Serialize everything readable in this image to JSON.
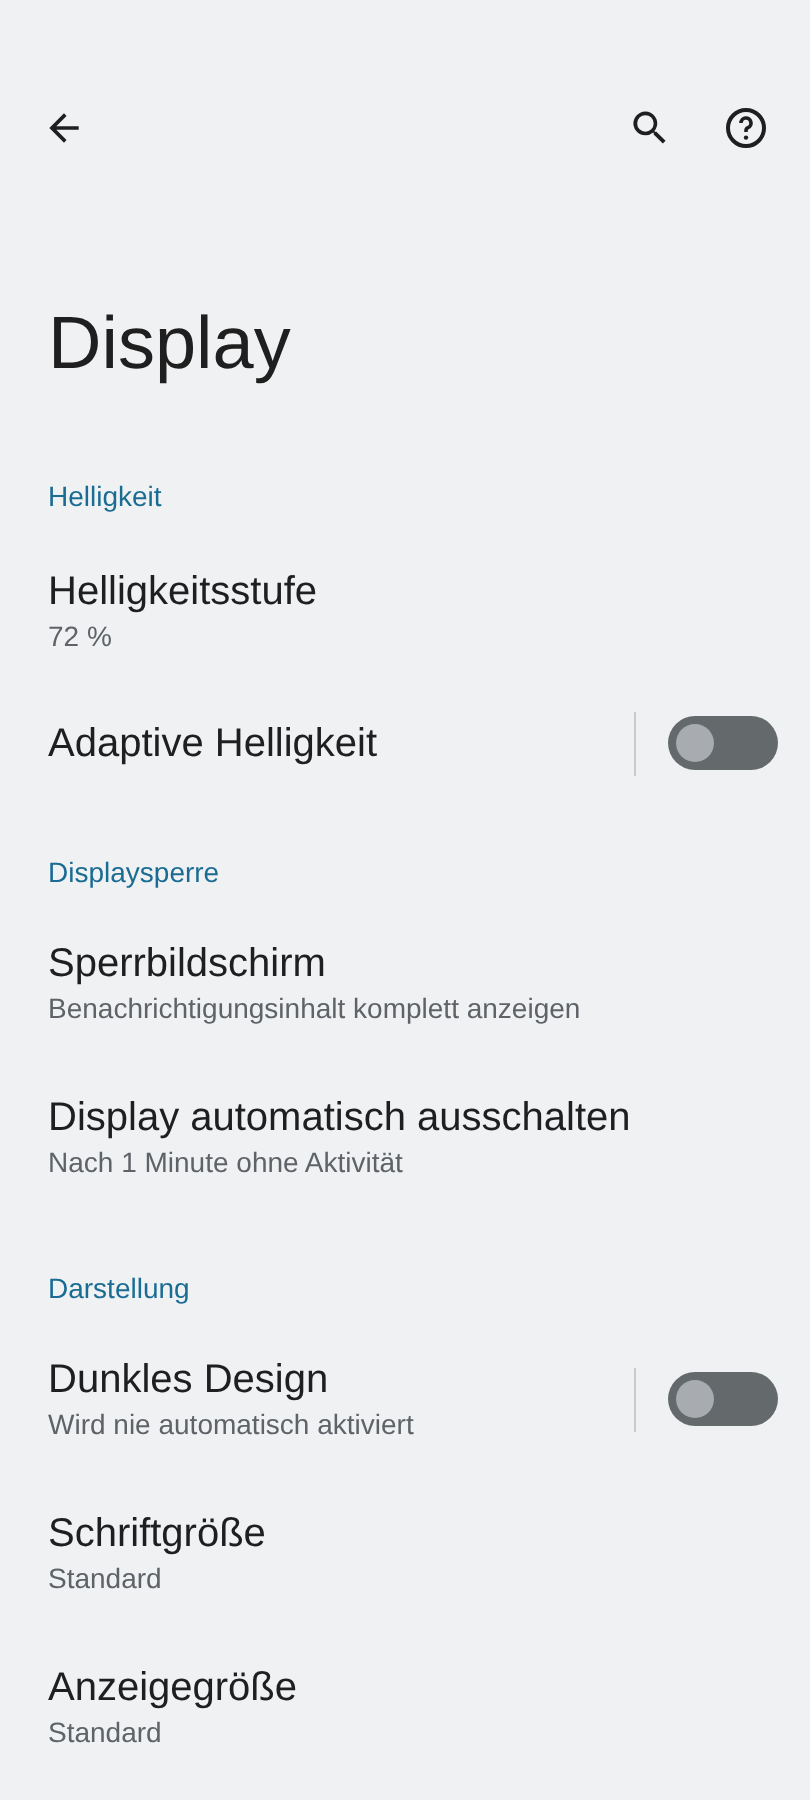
{
  "title": "Display",
  "sections": [
    {
      "header": "Helligkeit",
      "items": [
        {
          "kind": "text",
          "title": "Helligkeitsstufe",
          "subtitle": "72 %"
        },
        {
          "kind": "switch",
          "title": "Adaptive Helligkeit",
          "on": false
        }
      ]
    },
    {
      "header": "Displaysperre",
      "items": [
        {
          "kind": "text",
          "title": "Sperrbildschirm",
          "subtitle": "Benachrichtigungsinhalt komplett anzeigen"
        },
        {
          "kind": "text",
          "title": "Display automatisch ausschalten",
          "subtitle": "Nach 1 Minute ohne Aktivität"
        }
      ]
    },
    {
      "header": "Darstellung",
      "items": [
        {
          "kind": "switch",
          "title": "Dunkles Design",
          "subtitle": "Wird nie automatisch aktiviert",
          "on": false
        },
        {
          "kind": "text",
          "title": "Schriftgröße",
          "subtitle": "Standard"
        },
        {
          "kind": "text",
          "title": "Anzeigegröße",
          "subtitle": "Standard"
        }
      ]
    }
  ]
}
